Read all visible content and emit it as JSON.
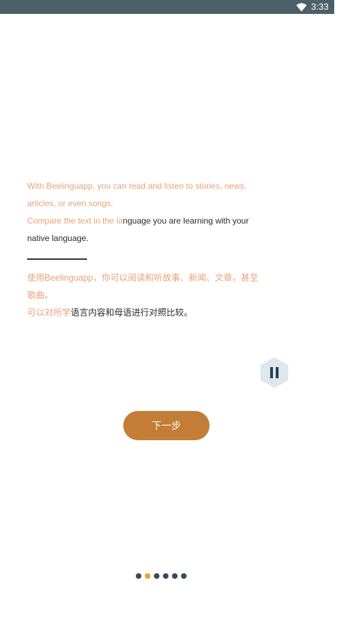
{
  "status_bar": {
    "time": "3:33",
    "wifi_icon": "wifi-icon"
  },
  "intro": {
    "en_line1": "With Beelinguapp, you can read and listen to stories, news,",
    "en_line2": "articles, or even songs.",
    "en_line3_highlight": "Compare the text in the la",
    "en_line3_rest": "nguage you are learning with your",
    "en_line4": "native language.",
    "zh_line1": "使用Beelinguapp，你可以阅读和听故事、新闻、文章，甚至",
    "zh_line2": "歌曲。",
    "zh_line3_highlight": "可以对所学",
    "zh_line3_rest": "语言内容和母语进行对照比较。"
  },
  "controls": {
    "pause_icon": "pause-icon",
    "next_label": "下一步"
  },
  "pagination": {
    "total": 6,
    "active_index": 1
  },
  "colors": {
    "status_bar": "#4d6068",
    "highlight_text": "#e9a17a",
    "body_text": "#2b2b2b",
    "next_button": "#c47d36",
    "pause_button_bg": "#dde8ee",
    "pause_icon": "#2f3f4a",
    "dot": "#3a4a55",
    "dot_active": "#e9a13a"
  }
}
